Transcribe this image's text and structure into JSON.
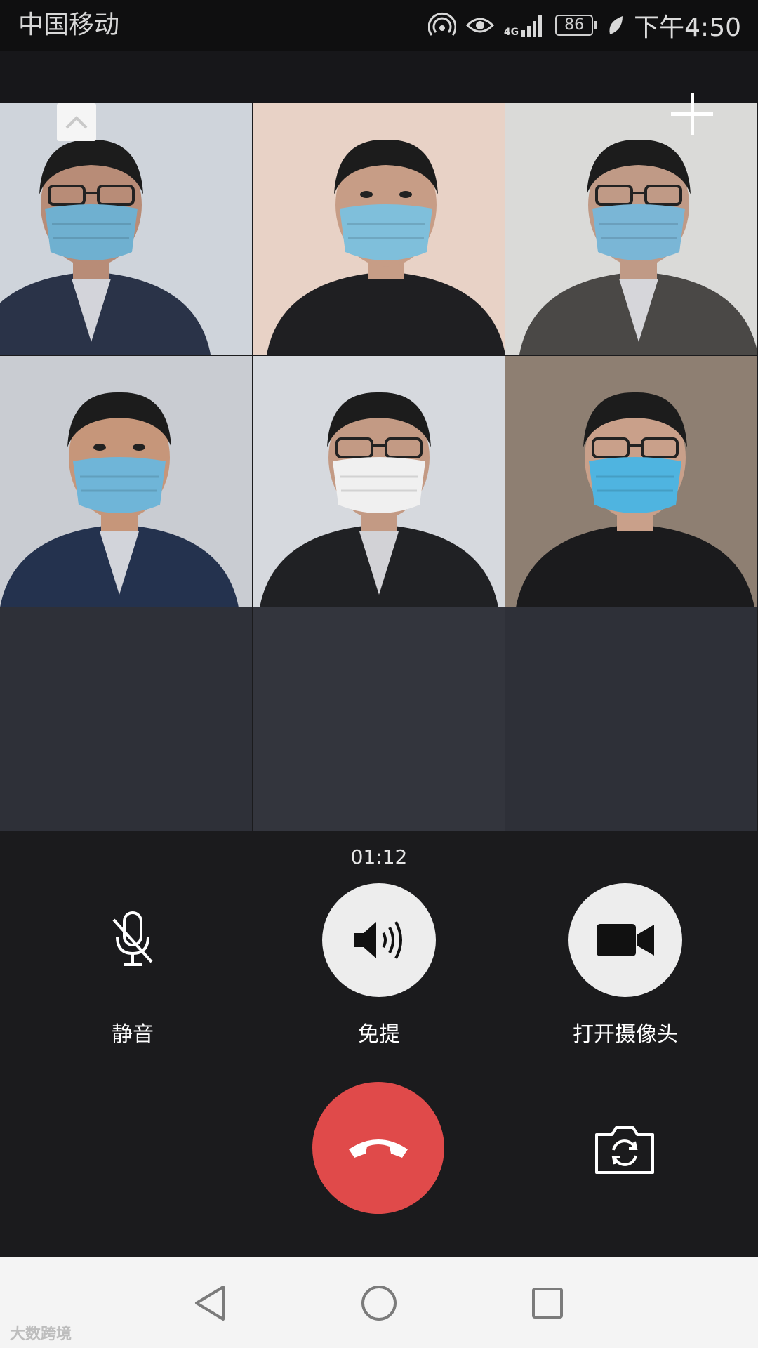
{
  "status_bar": {
    "carrier": "中国移动",
    "network": "4G",
    "battery": "86",
    "time": "下午4:50"
  },
  "icons": {
    "hotspot": "hotspot-icon",
    "eye": "eye-comfort-icon",
    "signal": "signal-icon",
    "battery": "battery-icon",
    "leaf": "power-saving-leaf-icon",
    "collapse": "chevron-up-icon",
    "add": "plus-icon",
    "mute": "mic-off-icon",
    "speaker": "speaker-icon",
    "camera": "video-camera-icon",
    "hangup": "phone-hangup-icon",
    "flip": "camera-flip-icon"
  },
  "call": {
    "duration": "01:12",
    "participants": [
      {
        "bg": "#cfd4db",
        "shirt": "#2a3348",
        "skin": "#b88c77",
        "mask": "#6fb0d0"
      },
      {
        "bg": "#e8d2c6",
        "shirt": "#1f1f22",
        "skin": "#c79d86",
        "mask": "#7fbfdb"
      },
      {
        "bg": "#dadad8",
        "shirt": "#4a4846",
        "skin": "#c09a86",
        "mask": "#7ab6d6"
      },
      {
        "bg": "#c9ccd2",
        "shirt": "#24324e",
        "skin": "#c6967a",
        "mask": "#6fb5d8"
      },
      {
        "bg": "#d6d9de",
        "shirt": "#202124",
        "skin": "#c39a84",
        "mask": "#f0f0f0"
      },
      {
        "bg": "#8e7f72",
        "shirt": "#1b1b1d",
        "skin": "#c9a08a",
        "mask": "#4fb4e0"
      }
    ]
  },
  "controls": {
    "mute_label": "静音",
    "speaker_label": "免提",
    "camera_label": "打开摄像头"
  },
  "watermark": "大数跨境",
  "colors": {
    "hangup_red": "#e04a4a",
    "control_bg": "#1b1b1d",
    "empty_tile": "#2e3038"
  }
}
